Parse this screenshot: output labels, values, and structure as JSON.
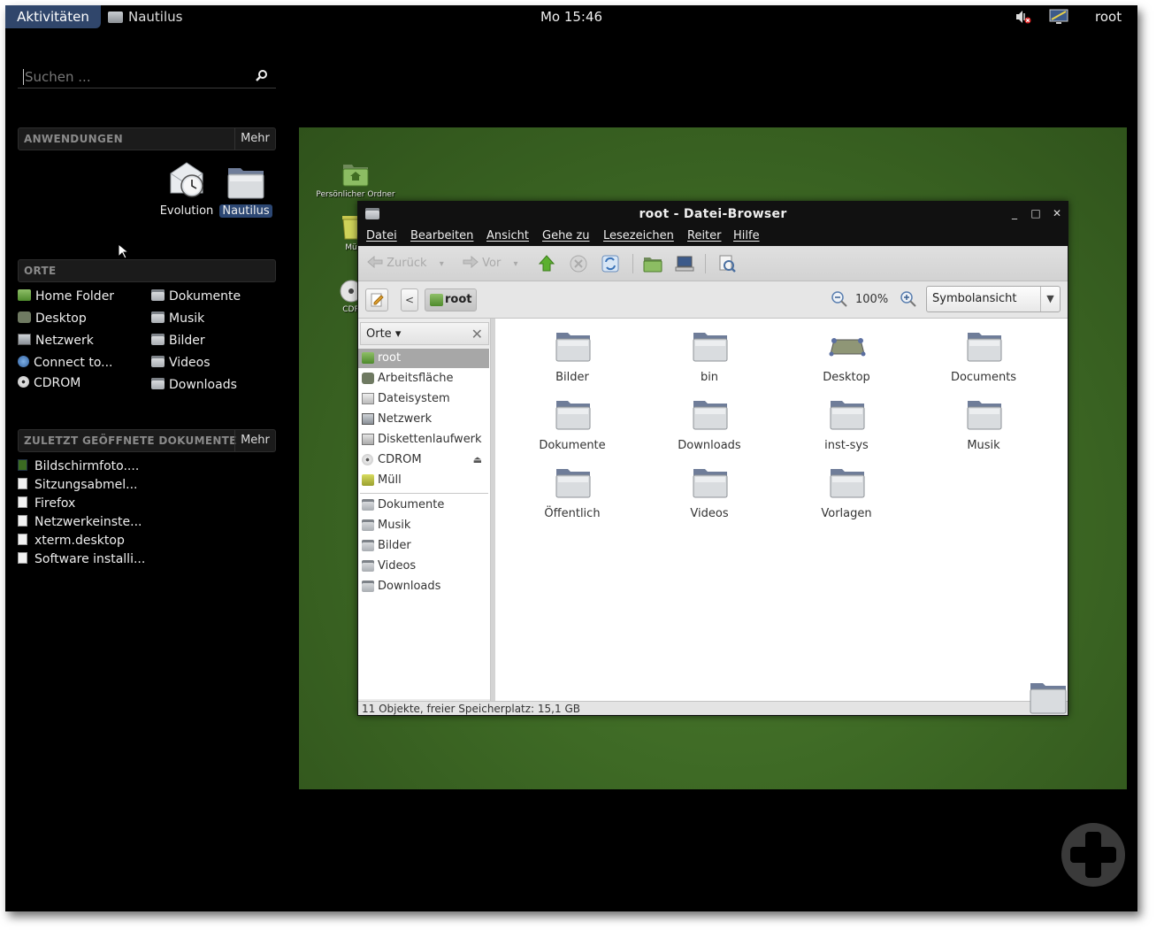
{
  "topbar": {
    "activities": "Aktivitäten",
    "app_menu": "Nautilus",
    "clock": "Mo 15:46",
    "user": "root"
  },
  "overview": {
    "search_placeholder": "Suchen ...",
    "applications": {
      "title": "ANWENDUNGEN",
      "more": "Mehr",
      "items": [
        {
          "label": "Evolution",
          "icon": "evolution-clock-icon"
        },
        {
          "label": "Nautilus",
          "icon": "folder-icon"
        }
      ]
    },
    "places": {
      "title": "ORTE",
      "left": [
        "Home Folder",
        "Desktop",
        "Netzwerk",
        "Connect to...",
        "CDROM"
      ],
      "right": [
        "Dokumente",
        "Musik",
        "Bilder",
        "Videos",
        "Downloads"
      ]
    },
    "recent": {
      "title": "ZULETZT GEÖFFNETE DOKUMENTE",
      "more": "Mehr",
      "items": [
        "Bildschirmfoto....",
        "Sitzungsabmel...",
        "Firefox",
        "Netzwerkeinste...",
        "xterm.desktop",
        "Software installi..."
      ]
    }
  },
  "workspace": {
    "icons": [
      {
        "label": "Persönlicher Ordner",
        "icon": "home-folder-icon"
      },
      {
        "label": "Mü",
        "icon": "trash-icon"
      },
      {
        "label": "CDR",
        "icon": "cdrom-icon"
      }
    ]
  },
  "window": {
    "title": "root - Datei-Browser",
    "menus": [
      "Datei",
      "Bearbeiten",
      "Ansicht",
      "Gehe zu",
      "Lesezeichen",
      "Reiter",
      "Hilfe"
    ],
    "toolbar": {
      "back": "Zurück",
      "forward": "Vor"
    },
    "location": {
      "path": "root",
      "zoom": "100%",
      "view": "Symbolansicht"
    },
    "sidebar": {
      "header": "Orte",
      "items": [
        "root",
        "Arbeitsfläche",
        "Dateisystem",
        "Netzwerk",
        "Diskettenlaufwerk",
        "CDROM",
        "Müll"
      ],
      "bookmarks": [
        "Dokumente",
        "Musik",
        "Bilder",
        "Videos",
        "Downloads"
      ]
    },
    "files": [
      "Bilder",
      "bin",
      "Desktop",
      "Documents",
      "Dokumente",
      "Downloads",
      "inst-sys",
      "Musik",
      "Öffentlich",
      "Videos",
      "Vorlagen"
    ],
    "status": "11 Objekte, freier Speicherplatz: 15,1 GB"
  },
  "colors": {
    "activities_bg": "#30466b",
    "wallpaper": "#3e6a25",
    "selection": "#a7a7a7"
  }
}
